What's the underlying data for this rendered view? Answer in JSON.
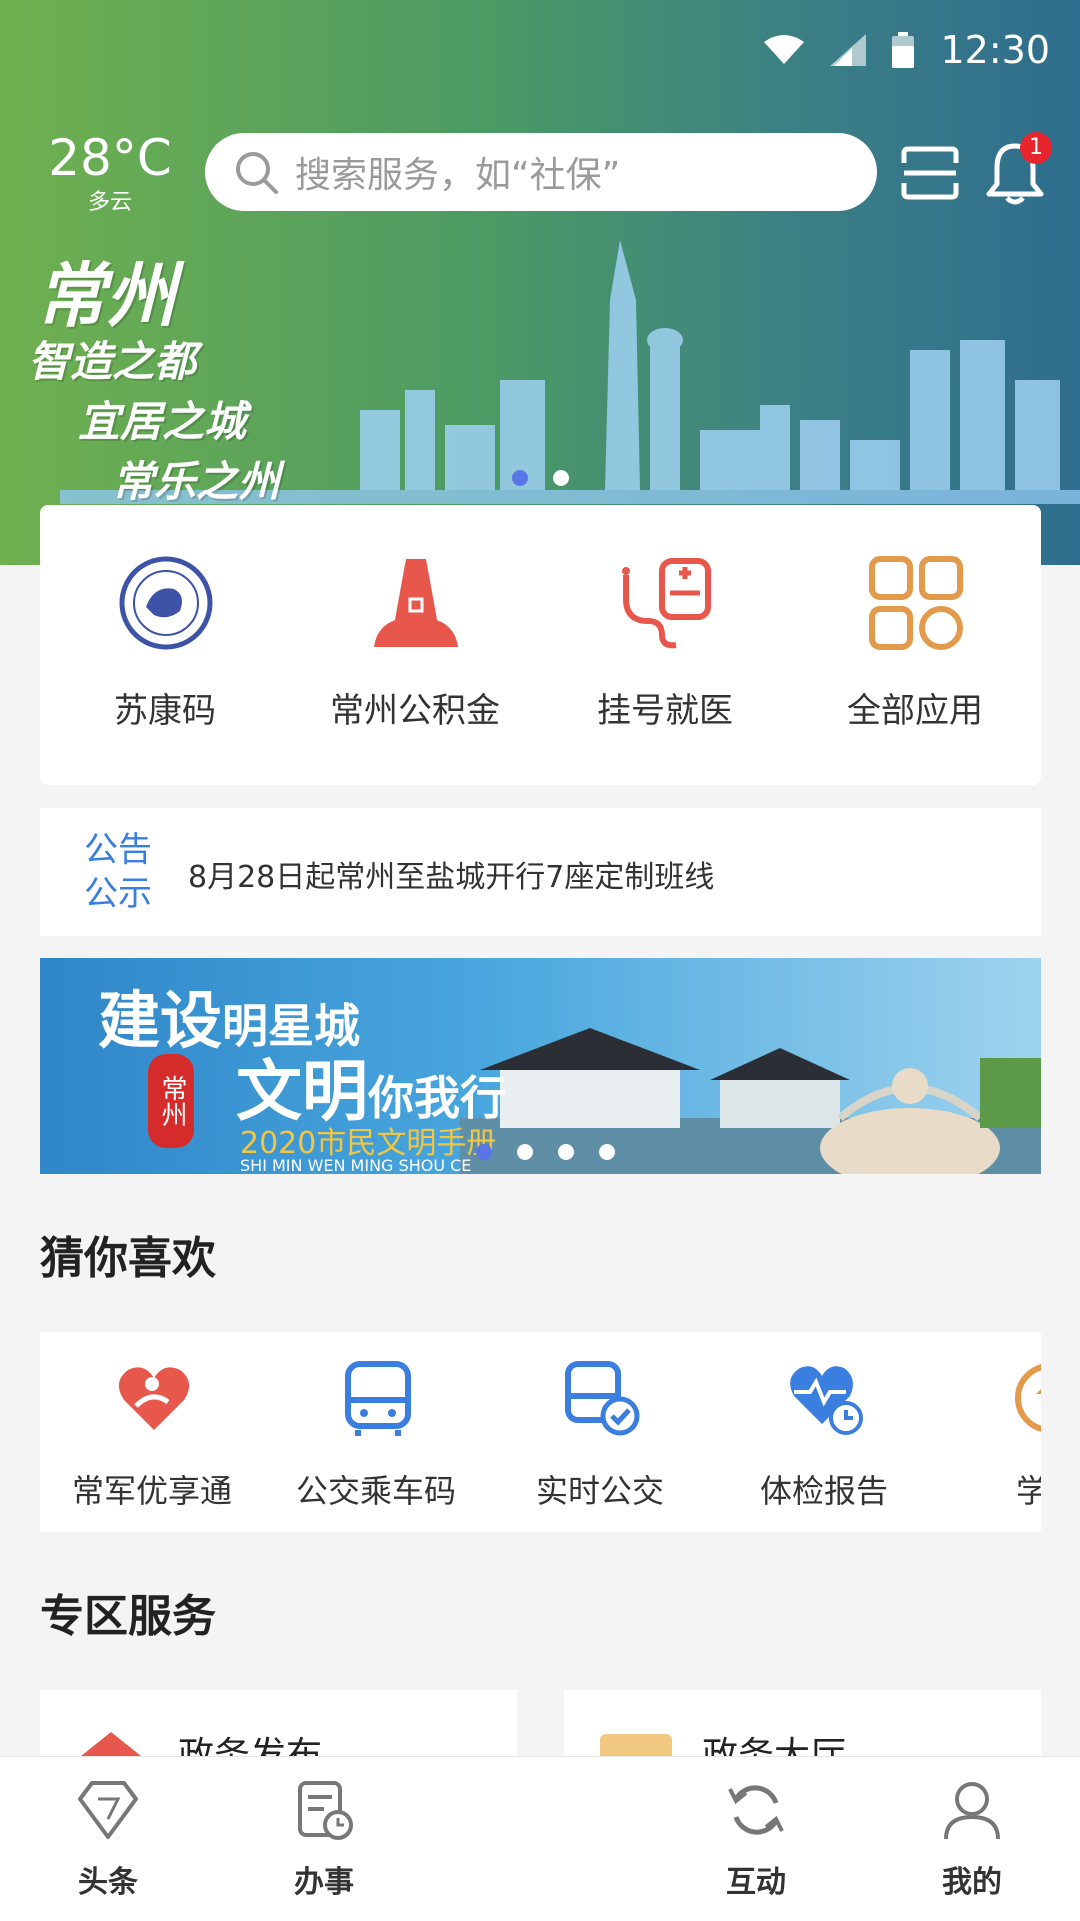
{
  "status": {
    "time": "12:30"
  },
  "weather": {
    "temp": "28°C",
    "condition": "多云"
  },
  "search": {
    "placeholder": "搜索服务，如“社保”"
  },
  "notifications": {
    "count": "1"
  },
  "banner": {
    "line1": "常州",
    "line2": "智造之都",
    "line3": "宜居之城",
    "line4": "常乐之州"
  },
  "apps": [
    {
      "label": "苏康码",
      "icon": "sukang-code-seal-icon"
    },
    {
      "label": "常州公积金",
      "icon": "housing-fund-icon"
    },
    {
      "label": "挂号就医",
      "icon": "stethoscope-medical-icon"
    },
    {
      "label": "全部应用",
      "icon": "all-apps-grid-icon"
    }
  ],
  "notice": {
    "tag_line1": "公告",
    "tag_line2": "公示",
    "text": "8月28日起常州至盐城开行7座定制班线"
  },
  "promo": {
    "line1a": "建设",
    "line1b": "明星城",
    "line2a": "文明",
    "line2b": "你我行",
    "line3": "2020市民文明手册",
    "line4": "SHI MIN WEN MING SHOU CE",
    "seal": "常州"
  },
  "favorites": {
    "title": "猜你喜欢",
    "items": [
      {
        "label": "常军优享通",
        "icon": "military-heart-icon"
      },
      {
        "label": "公交乘车码",
        "icon": "bus-icon"
      },
      {
        "label": "实时公交",
        "icon": "realtime-bus-check-icon"
      },
      {
        "label": "体检报告",
        "icon": "health-check-heart-icon"
      },
      {
        "label": "学区",
        "icon": "school-district-icon"
      }
    ]
  },
  "zones": {
    "title": "专区服务",
    "left": "政务发布",
    "right": "政务大厅"
  },
  "tabs": [
    {
      "label": "头条"
    },
    {
      "label": "办事"
    },
    {
      "label": ""
    },
    {
      "label": "互动"
    },
    {
      "label": "我的"
    }
  ],
  "colors": {
    "accent_blue": "#3a7ee0",
    "icon_red": "#e8574b",
    "icon_orange": "#e39a4a",
    "icon_blue": "#3a7ee0"
  }
}
